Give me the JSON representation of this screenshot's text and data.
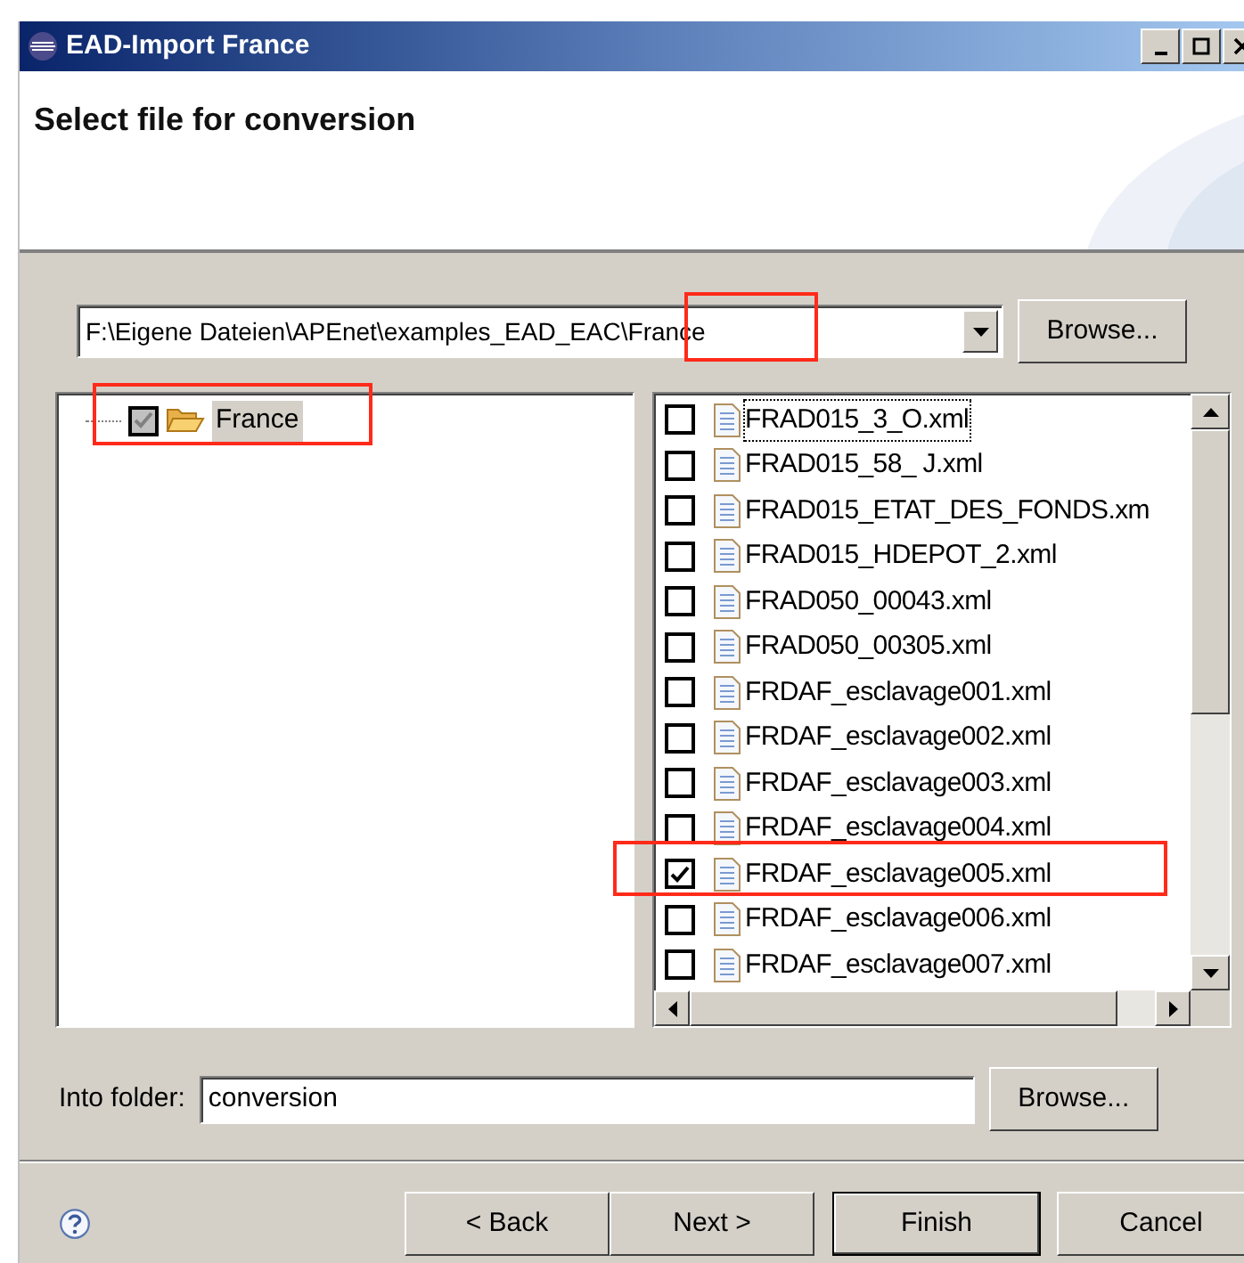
{
  "window": {
    "title": "EAD-Import France"
  },
  "header": {
    "title": "Select file for conversion"
  },
  "path_combo": {
    "value": "F:\\Eigene Dateien\\APEnet\\examples_EAD_EAC\\France"
  },
  "path_browse": "Browse...",
  "tree": {
    "items": [
      {
        "label": "France",
        "checked": true,
        "grayed": true,
        "selected": true
      }
    ]
  },
  "files": [
    {
      "name": "FRAD015_3_O.xml",
      "checked": false,
      "focused": true
    },
    {
      "name": "FRAD015_58_ J.xml",
      "checked": false,
      "focused": false
    },
    {
      "name": "FRAD015_ETAT_DES_FONDS.xm",
      "checked": false,
      "focused": false
    },
    {
      "name": "FRAD015_HDEPOT_2.xml",
      "checked": false,
      "focused": false
    },
    {
      "name": "FRAD050_00043.xml",
      "checked": false,
      "focused": false
    },
    {
      "name": "FRAD050_00305.xml",
      "checked": false,
      "focused": false
    },
    {
      "name": "FRDAF_esclavage001.xml",
      "checked": false,
      "focused": false
    },
    {
      "name": "FRDAF_esclavage002.xml",
      "checked": false,
      "focused": false
    },
    {
      "name": "FRDAF_esclavage003.xml",
      "checked": false,
      "focused": false
    },
    {
      "name": "FRDAF_esclavage004.xml",
      "checked": false,
      "focused": false
    },
    {
      "name": "FRDAF_esclavage005.xml",
      "checked": true,
      "focused": false
    },
    {
      "name": "FRDAF_esclavage006.xml",
      "checked": false,
      "focused": false
    },
    {
      "name": "FRDAF_esclavage007.xml",
      "checked": false,
      "focused": false
    }
  ],
  "folder": {
    "label": "Into folder:",
    "value": "conversion",
    "browse": "Browse..."
  },
  "buttons": [
    {
      "label": "< Back",
      "default": false
    },
    {
      "label": "Next >",
      "default": false
    },
    {
      "label": "Finish",
      "default": true
    },
    {
      "label": "Cancel",
      "default": false
    }
  ]
}
